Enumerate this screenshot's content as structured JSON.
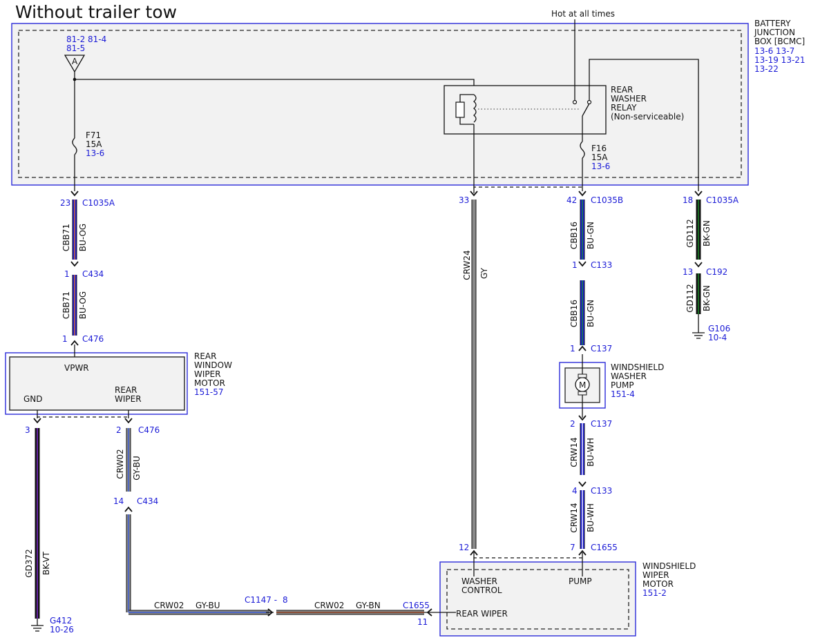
{
  "title": "Without trailer tow",
  "hot_label": "Hot at all times",
  "colors": {
    "BU-OG": [
      "#1a1ad6",
      "#e87722"
    ],
    "BU-GN": [
      "#1a1ad6",
      "#1f8f2a"
    ],
    "BK-GN": [
      "#111111",
      "#1f8f2a"
    ],
    "GY": [
      "#8a8a8a",
      "#8a8a8a"
    ],
    "GY-BU": [
      "#8a8a8a",
      "#3a5bd6"
    ],
    "GY-BN": [
      "#8a8a8a",
      "#8b3a1a"
    ],
    "BU-WH": [
      "#1a1ad6",
      "#ffffff"
    ],
    "BK-VT": [
      "#111111",
      "#8a2be2"
    ]
  },
  "bjb": {
    "name": [
      "BATTERY",
      "JUNCTION",
      "BOX [BCMC]"
    ],
    "refs": [
      "13-6  13-7",
      "13-19 13-21",
      "13-22"
    ],
    "splice_refs": [
      "81-2  81-4",
      "81-5"
    ],
    "splice_label": "A"
  },
  "fuses": [
    {
      "name": "F71",
      "rating": "15A",
      "ref": "13-6"
    },
    {
      "name": "F16",
      "rating": "15A",
      "ref": "13-6"
    }
  ],
  "relay": {
    "name": [
      "REAR",
      "WASHER",
      "RELAY",
      "(Non-serviceable)"
    ]
  },
  "components": {
    "rear_wiper_motor": {
      "name": [
        "REAR",
        "WINDOW",
        "WIPER",
        "MOTOR"
      ],
      "ref": "151-57",
      "pins": [
        "VPWR",
        "GND",
        "REAR",
        "WIPER"
      ]
    },
    "washer_pump": {
      "name": [
        "WINDSHIELD",
        "WASHER",
        "PUMP"
      ],
      "ref": "151-4",
      "symbol": "M"
    },
    "ws_wiper_motor": {
      "name": [
        "WINDSHIELD",
        "WIPER",
        "MOTOR"
      ],
      "ref": "151-2",
      "pins": [
        "WASHER",
        "CONTROL",
        "PUMP",
        "REAR WIPER"
      ]
    }
  },
  "connectors": [
    {
      "pin": "23",
      "name": "C1035A"
    },
    {
      "pin": "1",
      "name": "C434"
    },
    {
      "pin": "1",
      "name": "C476"
    },
    {
      "pin": "33",
      "name": ""
    },
    {
      "pin": "42",
      "name": "C1035B"
    },
    {
      "pin": "1",
      "name": "C133"
    },
    {
      "pin": "1",
      "name": "C137"
    },
    {
      "pin": "2",
      "name": "C137"
    },
    {
      "pin": "4",
      "name": "C133"
    },
    {
      "pin": "7",
      "name": "C1655"
    },
    {
      "pin": "12",
      "name": ""
    },
    {
      "pin": "18",
      "name": "C1035A"
    },
    {
      "pin": "13",
      "name": "C192"
    },
    {
      "pin": "3",
      "name": ""
    },
    {
      "pin": "2",
      "name": "C476"
    },
    {
      "pin": "14",
      "name": "C434"
    },
    {
      "pin": "8",
      "name": "C1147 -"
    },
    {
      "pin": "11",
      "name": "C1655"
    }
  ],
  "wires": [
    {
      "circuit": "CBB71",
      "color": "BU-OG"
    },
    {
      "circuit": "CBB71",
      "color": "BU-OG"
    },
    {
      "circuit": "CRW24",
      "color": "GY"
    },
    {
      "circuit": "CBB16",
      "color": "BU-GN"
    },
    {
      "circuit": "CBB16",
      "color": "BU-GN"
    },
    {
      "circuit": "CRW14",
      "color": "BU-WH"
    },
    {
      "circuit": "CRW14",
      "color": "BU-WH"
    },
    {
      "circuit": "GD112",
      "color": "BK-GN"
    },
    {
      "circuit": "GD112",
      "color": "BK-GN"
    },
    {
      "circuit": "GD372",
      "color": "BK-VT"
    },
    {
      "circuit": "CRW02",
      "color": "GY-BU"
    },
    {
      "circuit": "CRW02",
      "color": "GY-BU"
    },
    {
      "circuit": "CRW02",
      "color": "GY-BN"
    }
  ],
  "grounds": [
    {
      "name": "G106",
      "ref": "10-4"
    },
    {
      "name": "G412",
      "ref": "10-26"
    }
  ]
}
